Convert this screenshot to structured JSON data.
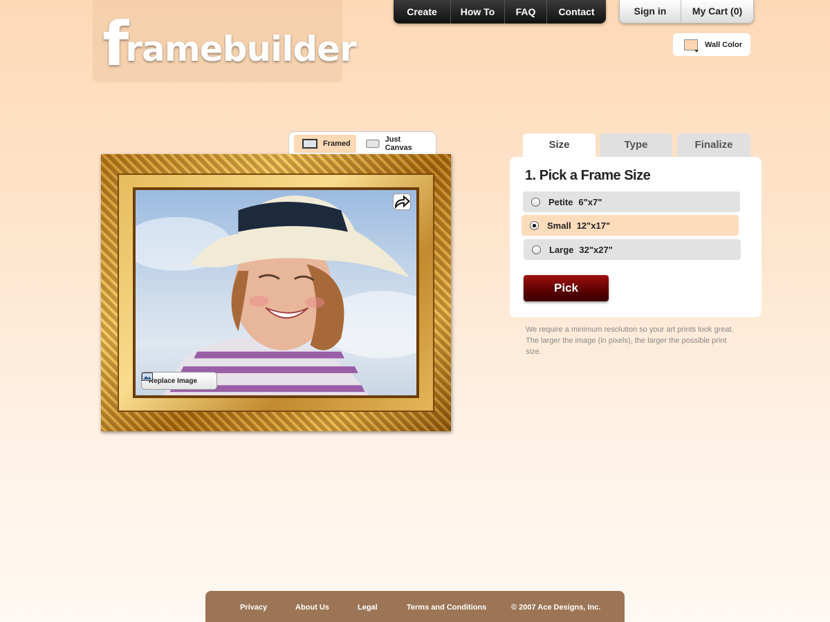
{
  "logo": {
    "first_letter": "f",
    "rest": "ramebuilder"
  },
  "nav": {
    "items": [
      "Create",
      "How To",
      "FAQ",
      "Contact"
    ],
    "sign_in": "Sign in",
    "cart": "My Cart (0)"
  },
  "wall_color": {
    "label": "Wall Color",
    "swatch": "#fdd5b0"
  },
  "view_toggle": {
    "framed": "Framed",
    "just_canvas": "Just Canvas",
    "active": "Framed"
  },
  "photo": {
    "replace_label": "Replace Image"
  },
  "tabs": [
    {
      "label": "Size",
      "active": true
    },
    {
      "label": "Type",
      "active": false
    },
    {
      "label": "Finalize",
      "active": false
    }
  ],
  "size_panel": {
    "title": "1. Pick a Frame Size",
    "options": [
      {
        "name": "Petite",
        "dims": "6\"x7\"",
        "selected": false
      },
      {
        "name": "Small",
        "dims": "12\"x17\"",
        "selected": true
      },
      {
        "name": "Large",
        "dims": "32\"x27\"",
        "selected": false
      }
    ],
    "pick_label": "Pick",
    "note": "We require a minimum resolution so your art prints look great. The larger the image (in pixels), the larger the possible print size."
  },
  "footer": {
    "privacy": "Privacy",
    "about": "About Us",
    "legal": "Legal",
    "terms": "Terms and Conditions",
    "copyright": "© 2007 Ace Designs, Inc."
  },
  "colors": {
    "accent": "#fdd9b6",
    "pick_button": "#7a0000",
    "footer": "#9b7555",
    "nav_dark": "#1a1a1a"
  }
}
